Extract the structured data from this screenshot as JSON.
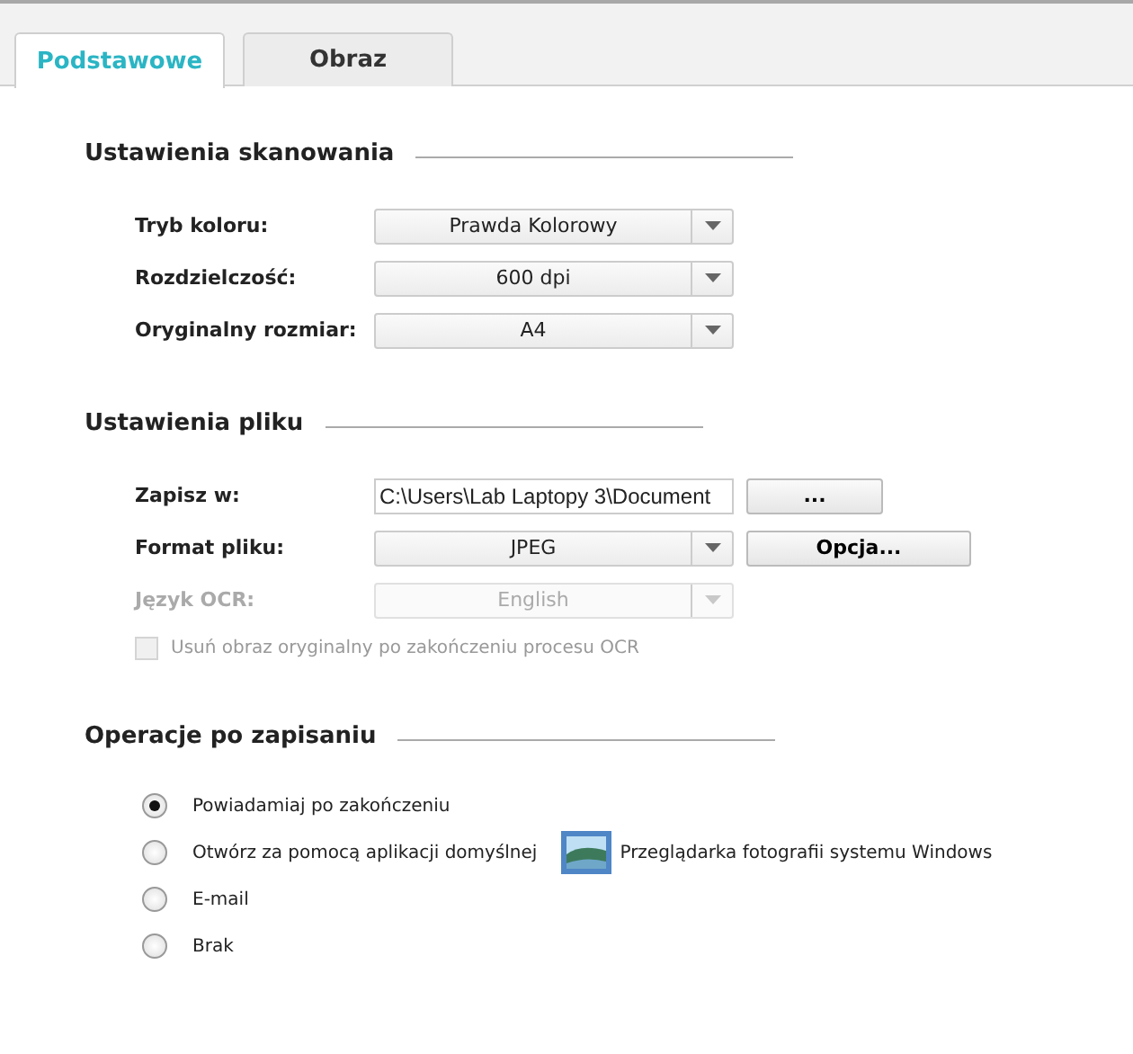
{
  "tabs": [
    {
      "label": "Podstawowe",
      "selected": true
    },
    {
      "label": "Obraz",
      "selected": false
    }
  ],
  "sections": [
    {
      "title": "Ustawienia skanowania",
      "rows": [
        {
          "kind": "dropdown",
          "label": "Tryb koloru:",
          "value": "Prawda Kolorowy",
          "disabled": false
        },
        {
          "kind": "dropdown",
          "label": "Rozdzielczość:",
          "value": "600 dpi",
          "disabled": false
        },
        {
          "kind": "dropdown",
          "label": "Oryginalny rozmiar:",
          "value": "A4",
          "disabled": false
        }
      ]
    },
    {
      "title": "Ustawienia pliku",
      "rows": [
        {
          "kind": "path",
          "label": "Zapisz w:",
          "value": "C:\\Users\\Lab Laptopy 3\\Document",
          "button": "..."
        },
        {
          "kind": "dropdown",
          "label": "Format pliku:",
          "value": "JPEG",
          "button": "Opcja...",
          "disabled": false
        },
        {
          "kind": "dropdown",
          "label": "Język OCR:",
          "value": "English",
          "disabled": true
        },
        {
          "kind": "checkbox",
          "label": "Usuń obraz oryginalny po zakończeniu procesu OCR",
          "checked": false,
          "disabled": true
        }
      ]
    },
    {
      "title": "Operacje po zapisaniu",
      "rows": [
        {
          "kind": "radio",
          "label": "Powiadamiaj po zakończeniu",
          "selected": true
        },
        {
          "kind": "radio",
          "label": "Otwórz za pomocą aplikacji domyślnej",
          "selected": false,
          "app": "Przeglądarka fotografii systemu Windows"
        },
        {
          "kind": "radio",
          "label": "E-mail",
          "selected": false
        },
        {
          "kind": "radio",
          "label": "Brak",
          "selected": false
        }
      ]
    }
  ]
}
